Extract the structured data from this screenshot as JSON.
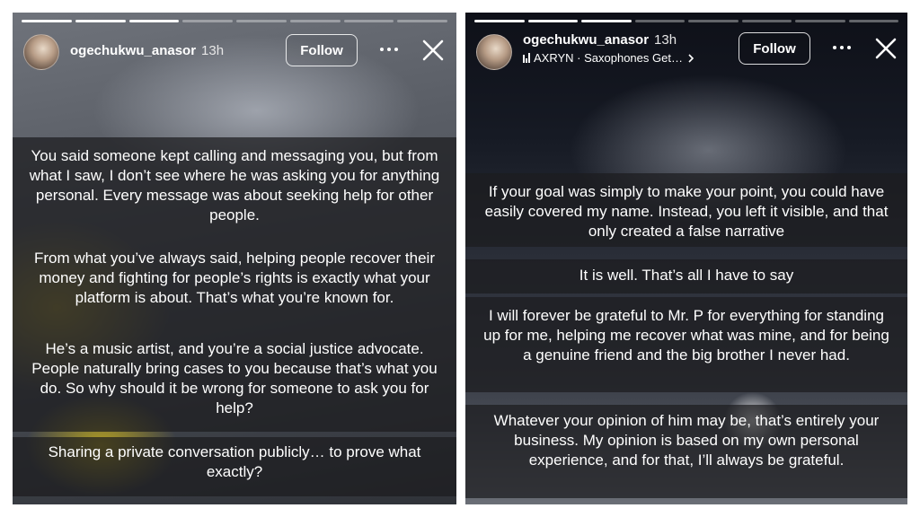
{
  "left_story": {
    "username": "ogechukwu_anasor",
    "time": "13h",
    "follow_label": "Follow",
    "paragraphs": [
      "You said someone kept calling and messaging you, but from what I saw, I don’t see where he was asking you for anything personal. Every message was about seeking help for other people.",
      "From what you’ve always said, helping people recover their money and fighting for people’s rights is exactly what your platform is about. That’s what you’re known for.",
      "He’s a music artist, and you’re a social justice advocate. People naturally bring cases to you because that’s what you do. So why should it be wrong for someone to ask you for help?",
      "Sharing a private conversation publicly… to prove what exactly?"
    ]
  },
  "right_story": {
    "username": "ogechukwu_anasor",
    "time": "13h",
    "music": "AXRYN · Saxophones Get…",
    "follow_label": "Follow",
    "paragraphs": [
      "If your goal was simply to make your point, you could have easily covered my name. Instead, you left it visible, and that only created a false narrative",
      "It is well. That’s all I have to say",
      "I will forever be grateful to Mr. P for everything for standing up for me, helping me recover what was mine, and for being a genuine friend and the big brother I never had.",
      "Whatever your opinion of him may be, that’s entirely your business. My opinion is based on my own personal experience, and for that, I’ll always be grateful."
    ]
  },
  "icons": {
    "more": "more-dots-icon",
    "close": "close-x-icon",
    "music": "music-bars-icon",
    "chevron": "chevron-right-icon"
  },
  "colors": {
    "text_box": "#1c1c1e",
    "text": "#ffffff"
  }
}
